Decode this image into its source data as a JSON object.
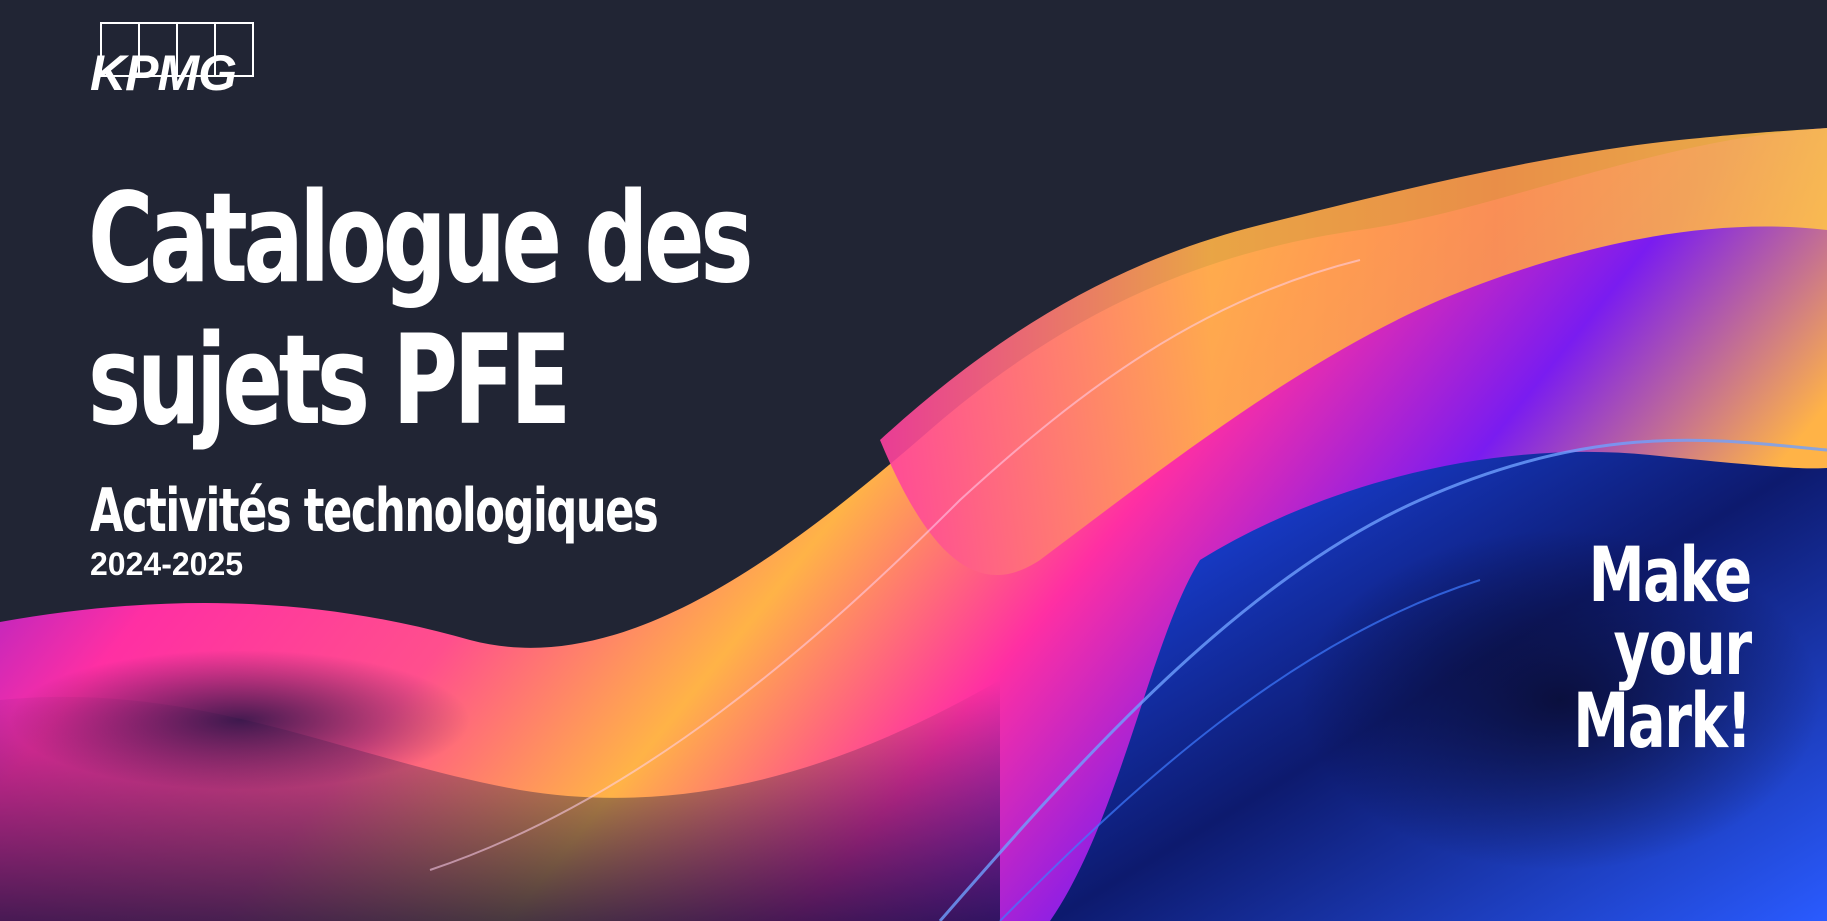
{
  "brand": {
    "logo_text": "KPMG",
    "logo_color": "#ffffff"
  },
  "hero": {
    "title_line_1": "Catalogue des",
    "title_line_2": "sujets PFE",
    "subtitle": "Activités technologiques",
    "year": "2024-2025"
  },
  "tagline": {
    "line_1": "Make",
    "line_2": "your",
    "line_3": "Mark!"
  },
  "colors": {
    "background": "#212534",
    "accent_orange": "#ffb347",
    "accent_pink": "#ff2fa3",
    "accent_purple": "#7a1cf0",
    "accent_blue": "#1d4fff",
    "text": "#ffffff"
  }
}
